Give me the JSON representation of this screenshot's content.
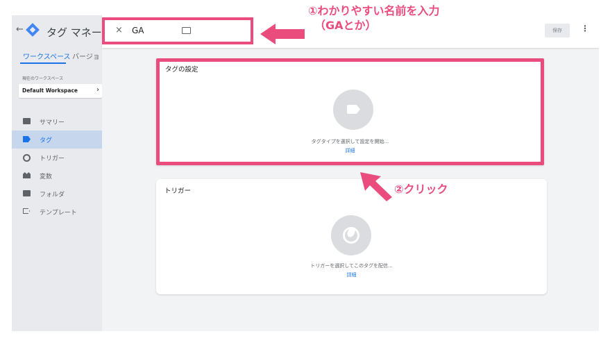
{
  "sidebar": {
    "back_icon": "←",
    "app_title": "タグ マネー",
    "tabs": [
      {
        "label": "ワークスペース"
      },
      {
        "label": "バージョ"
      }
    ],
    "workspace_label": "現在のワークスペース",
    "workspace_name": "Default Workspace",
    "workspace_chevron": "›",
    "nav": [
      {
        "label": "サマリー",
        "icon": "folder-icon"
      },
      {
        "label": "タグ",
        "icon": "tag-icon"
      },
      {
        "label": "トリガー",
        "icon": "trigger-icon"
      },
      {
        "label": "変数",
        "icon": "variables-icon"
      },
      {
        "label": "フォルダ",
        "icon": "folder-icon"
      },
      {
        "label": "テンプレート",
        "icon": "template-icon"
      }
    ]
  },
  "topbar": {
    "close_icon": "×",
    "tag_name": "GA",
    "save_label": "保存",
    "more_icon": "⋮"
  },
  "tag_card": {
    "title": "タグの設定",
    "hint": "タグタイプを選択して設定を開始...",
    "link": "詳細"
  },
  "trigger_card": {
    "title": "トリガー",
    "hint": "トリガーを選択してこのタグを配信...",
    "link": "詳細"
  },
  "annotations": {
    "step1_line1": "①わかりやすい名前を入力",
    "step1_line2": "（GAとか）",
    "step2": "②クリック"
  },
  "colors": {
    "annotation": "#ea4c7d",
    "accent": "#1a73e8"
  }
}
